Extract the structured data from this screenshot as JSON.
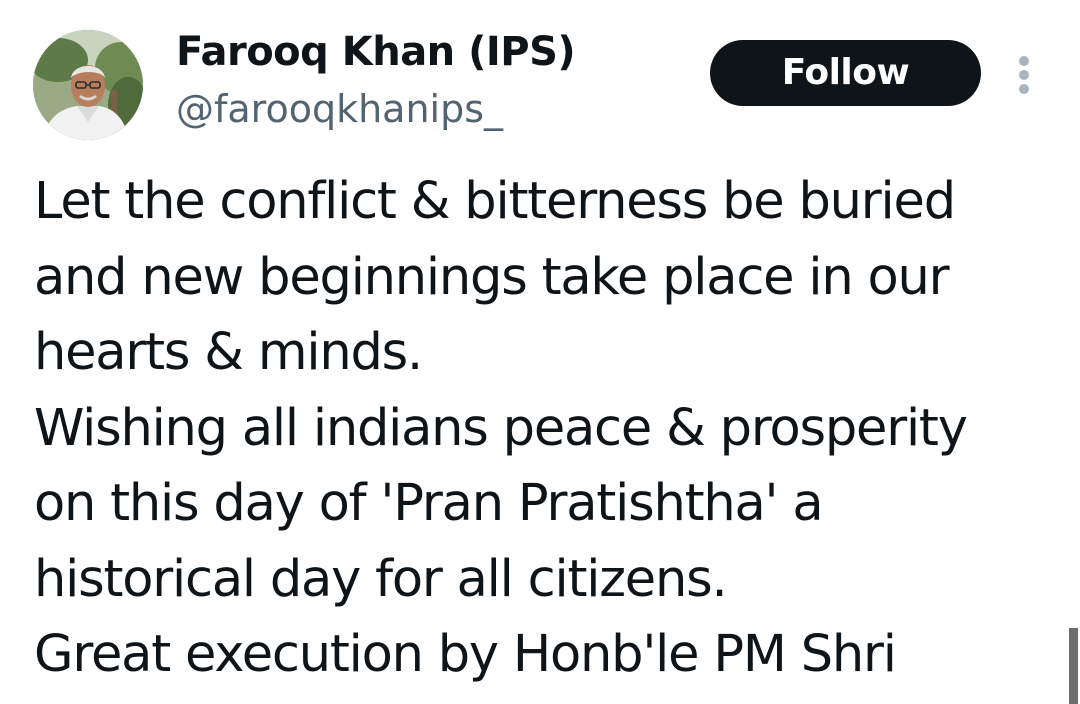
{
  "author": {
    "display_name": "Farooq Khan (IPS)",
    "handle": "@farooqkhanips_",
    "avatar_icon": "profile-photo"
  },
  "actions": {
    "follow_label": "Follow",
    "more_icon": "more-vertical-icon"
  },
  "tweet": {
    "lines": [
      "Let the conflict & bitterness be buried",
      "and new beginnings take place in our",
      "hearts & minds.",
      "Wishing all indians peace & prosperity",
      "on this day of 'Pran Pratishtha' a",
      "historical day for all citizens.",
      "Great execution by Honb'le PM Shri"
    ]
  },
  "colors": {
    "text_primary": "#0f1419",
    "text_secondary": "#536471",
    "button_bg": "#0f1419",
    "button_text": "#ffffff",
    "more_dots": "#a9b4bd"
  }
}
